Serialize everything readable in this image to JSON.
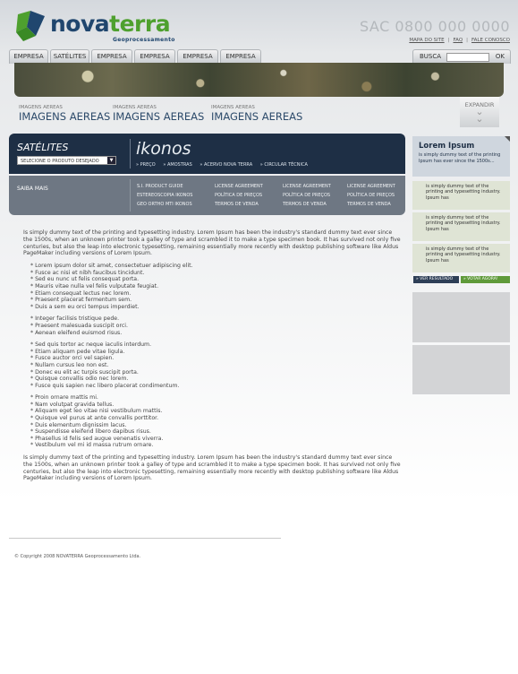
{
  "logo": {
    "name_part1": "nova",
    "name_part2": "terra",
    "subtitle": "Geoprocessamento"
  },
  "header": {
    "sac": "SAC 0800 000 0000",
    "links": [
      "MAPA DO SITE",
      "FAQ",
      "FALE CONOSCO"
    ],
    "link_separator": "|"
  },
  "tabs": [
    "EMPRESA",
    "SATÉLITES",
    "EMPRESA",
    "EMPRESA",
    "EMPRESA",
    "EMPRESA"
  ],
  "search": {
    "label": "BUSCA",
    "value": "",
    "button": "OK"
  },
  "image_headings": [
    {
      "small": "IMAGENS AEREAS",
      "big": "IMAGENS AEREAS"
    },
    {
      "small": "IMAGENS AEREAS",
      "big": "IMAGENS AEREAS"
    },
    {
      "small": "IMAGENS AEREAS",
      "big": "IMAGENS AEREAS"
    }
  ],
  "expand": {
    "label": "EXPANDIR",
    "icon": "chevron-down-double-icon"
  },
  "satellites": {
    "title": "SATÉLITES",
    "select_value": "SELECIONE O PRODUTO DESEJADO",
    "product": "ikonos",
    "links": [
      "» PREÇO",
      "» AMOSTRAS",
      "» ACERVO NOVA TERRA",
      "» CIRCULAR TÉCNICA"
    ]
  },
  "saiba": {
    "title": "SAIBA MAIS",
    "col1": [
      "S.I. PRODUCT GUIDE",
      "ESTEREOSCOPIA IKONOS",
      "GEO ORTHO   MTI IKONOS"
    ],
    "col2": [
      "LICENSE AGREEMENT",
      "POLÍTICA DE PREÇOS",
      "TERMOS DE VENDA"
    ],
    "col3": [
      "LICENSE AGREEMENT",
      "POLÍTICA DE PREÇOS",
      "TERMOS DE VENDA"
    ],
    "col4": [
      "LICENSE AGREEMENT",
      "POLÍTICA DE PREÇOS",
      "TERMOS DE VENDA"
    ]
  },
  "content": {
    "para1": "Is simply dummy text of the printing and typesetting industry. Lorem Ipsum has been the industry's standard dummy text ever since the 1500s, when an unknown printer took a galley of type and scrambled it to make a type specimen book. It has survived not only five centuries, but also the leap into electronic typesetting, remaining essentially more recently with desktop publishing software like Aldus PageMaker including versions of Lorem Ipsum.",
    "list1": [
      "Lorem ipsum dolor sit amet, consectetuer adipiscing elit.",
      "Fusce ac nisi et nibh faucibus tincidunt.",
      "Sed eu nunc ut felis consequat porta.",
      "Mauris vitae nulla vel felis vulputate feugiat.",
      "Etiam consequat lectus nec lorem.",
      "Praesent placerat fermentum sem.",
      "Duis a sem eu orci tempus imperdiet."
    ],
    "list2": [
      "Integer facilisis tristique pede.",
      "Praesent malesuada suscipit orci.",
      "Aenean eleifend euismod risus."
    ],
    "list3": [
      "Sed quis tortor ac neque iaculis interdum.",
      "Etiam aliquam pede vitae ligula.",
      "Fusce auctor orci vel sapien.",
      "Nullam cursus leo non est.",
      "Donec eu elit ac turpis suscipit porta.",
      "Quisque convallis odio nec lorem.",
      "Fusce quis sapien nec libero placerat condimentum."
    ],
    "list4": [
      "Proin ornare mattis mi.",
      "Nam volutpat gravida tellus.",
      "Aliquam eget leo vitae nisi vestibulum mattis.",
      "Quisque vel purus at ante convallis porttitor.",
      "Duis elementum dignissim lacus.",
      "Suspendisse eleifend libero dapibus risus.",
      "Phasellus id felis sed augue venenatis viverra.",
      "Vestibulum vel mi id massa rutrum ornare."
    ],
    "para2": "Is simply dummy text of the printing and typesetting industry. Lorem Ipsum has been the industry's standard dummy text ever since the 1500s, when an unknown printer took a galley of type and scrambled it to make a type specimen book. It has survived not only five centuries, but also the leap into electronic typesetting, remaining essentially more recently with desktop publishing software like Aldus PageMaker including versions of Lorem Ipsum."
  },
  "footer": {
    "copyright": "© Copyright 2008 NOVATERRA Geoprocessamento Ltda."
  },
  "sidebar": {
    "lorem_title": "Lorem Ipsum",
    "lorem_text": "is simply dummy text of the printing Ipsum has ever since the 1500s...",
    "items": [
      "is simply dummy text of the printing and typesetting industry. Ipsum has",
      "is simply dummy text of the printing and typesetting industry. Ipsum has",
      "is simply dummy text of the printing and typesetting industry. Ipsum has"
    ],
    "btn_results": "» VER RESULTADO",
    "btn_vote": "» VOTAR AGORA!"
  },
  "colors": {
    "brand_blue": "#20466e",
    "brand_green": "#4ea02e",
    "panel_dark": "#1e2f45",
    "panel_grey": "#6e7783"
  }
}
